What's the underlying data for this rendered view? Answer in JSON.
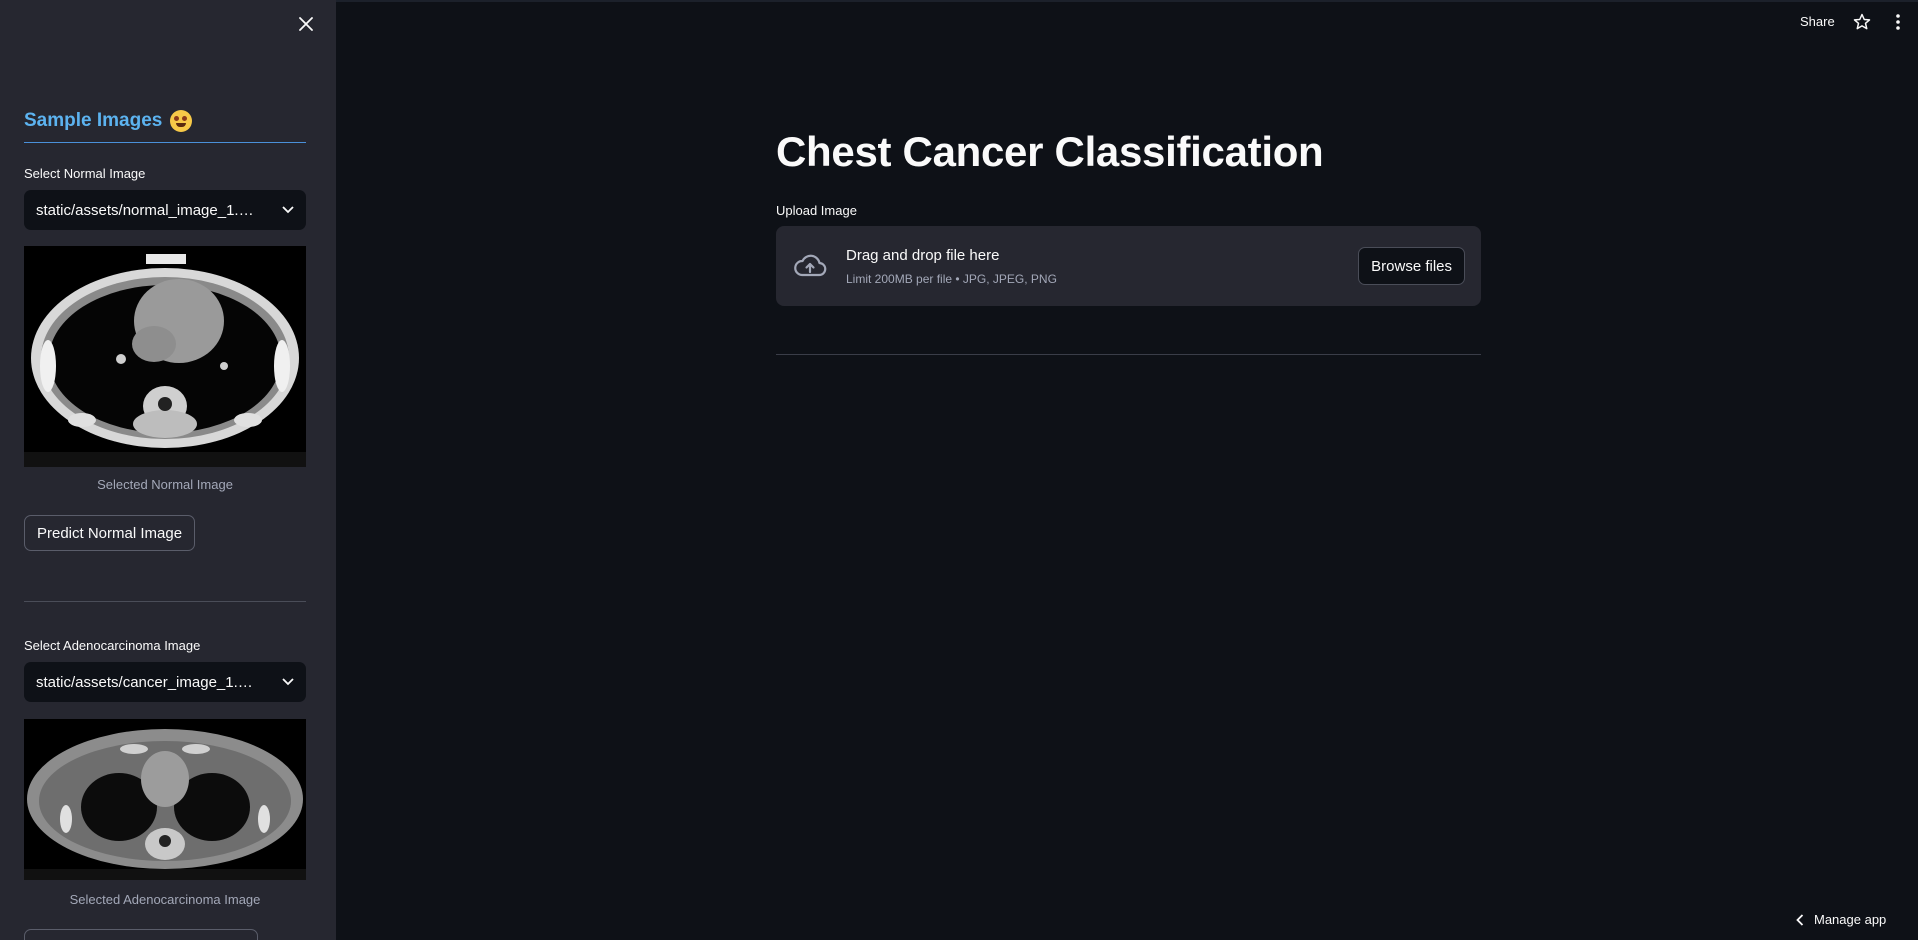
{
  "sidebar": {
    "heading": "Sample Images",
    "normal": {
      "label": "Select Normal Image",
      "selected": "static/assets/normal_image_1.png",
      "caption": "Selected Normal Image",
      "button": "Predict Normal Image"
    },
    "adeno": {
      "label": "Select Adenocarcinoma Image",
      "selected": "static/assets/cancer_image_1.png",
      "caption": "Selected Adenocarcinoma Image"
    }
  },
  "header": {
    "share": "Share"
  },
  "main": {
    "title": "Chest Cancer Classification",
    "upload_label": "Upload Image",
    "dropzone_title": "Drag and drop file here",
    "dropzone_limit": "Limit 200MB per file • JPG, JPEG, PNG",
    "browse": "Browse files"
  },
  "footer": {
    "manage": "Manage app"
  },
  "colors": {
    "background": "#0e1117",
    "sidebar": "#262730",
    "accent": "#5cb3f0"
  }
}
